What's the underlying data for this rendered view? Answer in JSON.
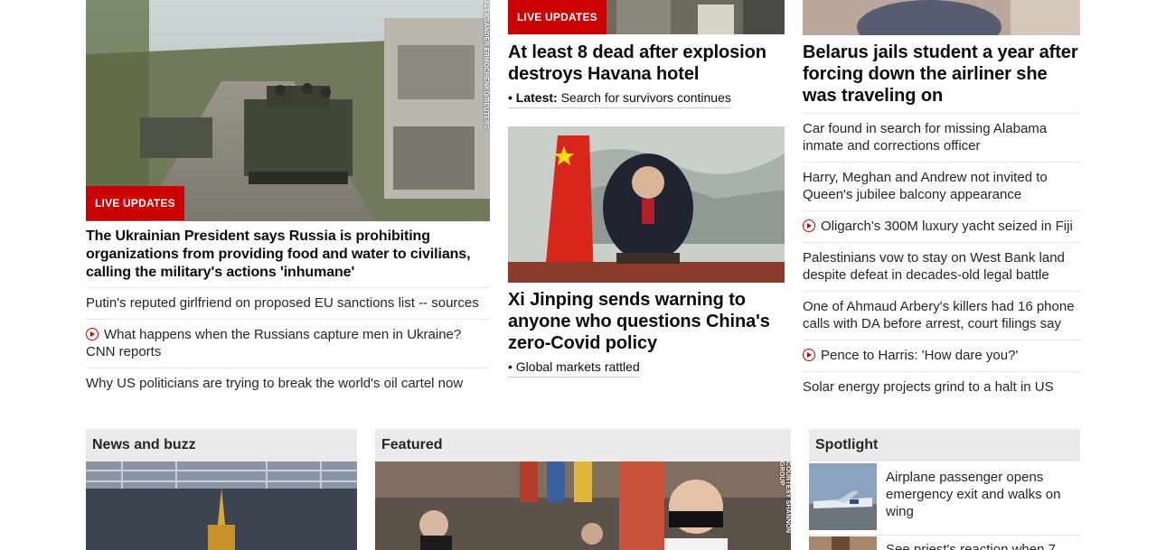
{
  "col1": {
    "badge": "LIVE UPDATES",
    "credit": "ALEKSANDER ERMOCHENKO/REUTERS",
    "headline": "The Ukrainian President says Russia is prohibiting organizations from providing food and water to civilians, calling the military's actions 'inhumane'",
    "links": [
      {
        "text": "Putin's reputed girlfriend on proposed EU sanctions list -- sources",
        "video": false
      },
      {
        "text": "What happens when the Russians capture men in Ukraine? CNN reports",
        "video": true
      },
      {
        "text": "Why US politicians are trying to break the world's oil cartel now",
        "video": false
      }
    ]
  },
  "col2": {
    "badge": "LIVE UPDATES",
    "story1": {
      "headline": "At least 8 dead after explosion destroys Havana hotel",
      "latest_prefix": "• Latest:",
      "latest_text": "Search for survivors continues"
    },
    "story2": {
      "headline": "Xi Jinping sends warning to anyone who questions China's zero-Covid policy",
      "sub": "• Global markets rattled"
    }
  },
  "col3": {
    "headline": "Belarus jails student a year after forcing down the airliner she was traveling on",
    "links": [
      {
        "text": "Car found in search for missing Alabama inmate and corrections officer",
        "video": false
      },
      {
        "text": "Harry, Meghan and Andrew not invited to Queen's jubilee balcony appearance",
        "video": false
      },
      {
        "text": "Oligarch's 300M luxury yacht seized in Fiji",
        "video": true
      },
      {
        "text": "Palestinians vow to stay on West Bank land despite defeat in decades-old legal battle",
        "video": false
      },
      {
        "text": "One of Ahmaud Arbery's killers had 16 phone calls with DA before arrest, court filings say",
        "video": false
      },
      {
        "text": "Pence to Harris: 'How dare you?'",
        "video": true
      },
      {
        "text": "Solar energy projects grind to a halt in US",
        "video": false
      }
    ]
  },
  "sections": {
    "news_buzz": "News and buzz",
    "featured": "Featured",
    "featured_credit": "COURTESY SHANNON GROUP",
    "spotlight": "Spotlight",
    "spot1": "Airplane passenger opens emergency exit and walks on wing",
    "spot2": "See priest's reaction when 7"
  },
  "colors": {
    "accent": "#cc0000",
    "section_bg": "#eaeaea"
  }
}
